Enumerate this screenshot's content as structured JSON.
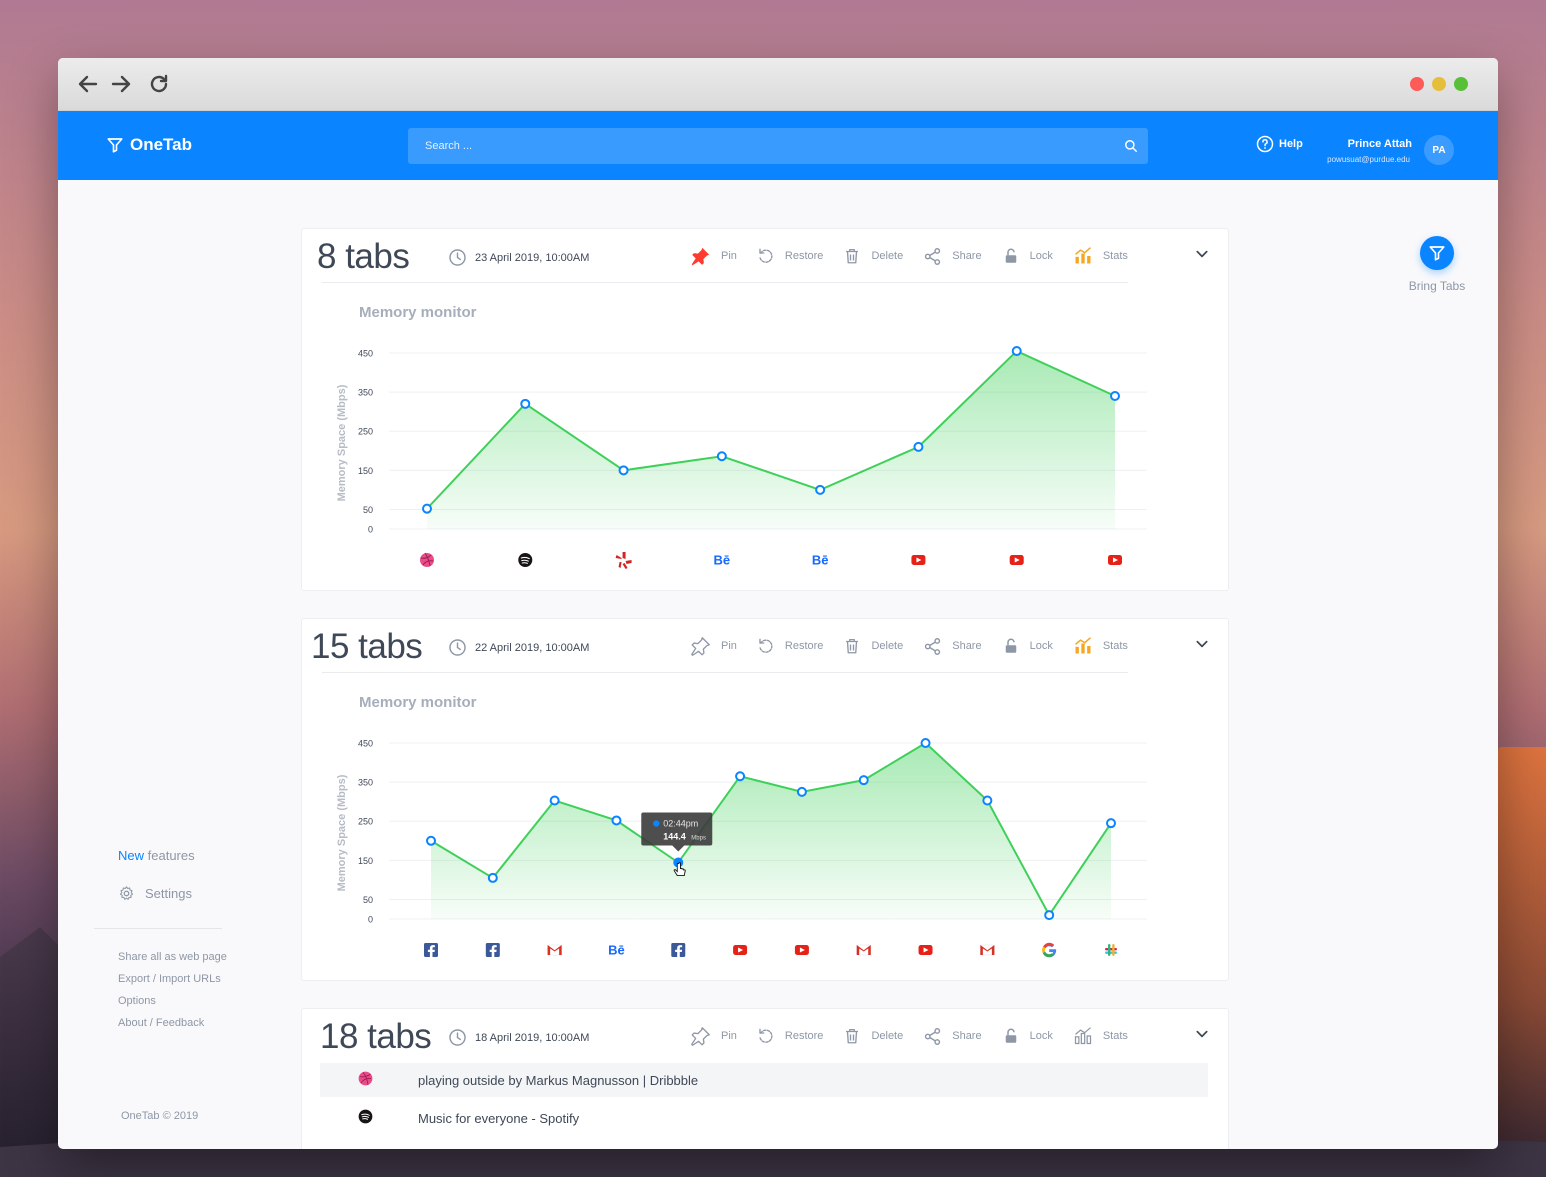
{
  "app": {
    "name": "OneTab"
  },
  "search": {
    "placeholder": "Search ..."
  },
  "header": {
    "help_label": "Help",
    "user_name": "Prince Attah",
    "user_email": "powusuat@purdue.edu",
    "user_initials": "PA"
  },
  "sidebar": {
    "new_label": "New",
    "features_label": "features",
    "settings_label": "Settings",
    "links": [
      "Share all as web page",
      "Export / Import URLs",
      "Options",
      "About / Feedback"
    ],
    "copyright": "OneTab © 2019"
  },
  "bring_tabs": {
    "label": "Bring Tabs"
  },
  "colors": {
    "accent": "#0a84ff",
    "line": "#3fd05a",
    "area": "#3fd05a",
    "pin_active": "#ff3b30",
    "stats_active": "#f5a623",
    "icon_muted": "#8e97a6"
  },
  "actions": {
    "pin": "Pin",
    "restore": "Restore",
    "delete": "Delete",
    "share": "Share",
    "lock": "Lock",
    "stats": "Stats"
  },
  "groups": [
    {
      "count_label": "8 tabs",
      "date": "23 April 2019, 10:00AM",
      "pinned": true,
      "stats_active": true,
      "chart_title": "Memory monitor"
    },
    {
      "count_label": "15 tabs",
      "date": "22 April 2019, 10:00AM",
      "pinned": false,
      "stats_active": true,
      "chart_title": "Memory monitor",
      "tooltip": {
        "time": "02:44pm",
        "value": "144.4",
        "unit": "Mbps"
      }
    },
    {
      "count_label": "18 tabs",
      "date": "18 April 2019, 10:00AM",
      "pinned": false,
      "stats_active": false,
      "tabs": [
        {
          "icon": "dribbble-icon",
          "title": "playing outside by Markus Magnusson | Dribbble"
        },
        {
          "icon": "spotify-icon",
          "title": "Music for everyone - Spotify"
        }
      ]
    }
  ],
  "chart_data": [
    {
      "type": "area",
      "title": "Memory monitor",
      "ylabel": "Memory Space (Mbps)",
      "ylim": [
        0,
        450
      ],
      "yticks": [
        0,
        50,
        150,
        250,
        350,
        450
      ],
      "grid": true,
      "categories": [
        "dribbble",
        "spotify",
        "yelp",
        "behance",
        "behance",
        "youtube",
        "youtube",
        "youtube"
      ],
      "values": [
        52,
        320,
        150,
        186,
        100,
        210,
        455,
        340
      ]
    },
    {
      "type": "area",
      "title": "Memory monitor",
      "ylabel": "Memory Space (Mbps)",
      "ylim": [
        0,
        450
      ],
      "yticks": [
        0,
        50,
        150,
        250,
        350,
        450
      ],
      "grid": true,
      "categories": [
        "facebook",
        "facebook",
        "gmail",
        "behance",
        "facebook",
        "youtube",
        "youtube",
        "gmail",
        "youtube",
        "gmail",
        "google",
        "slack"
      ],
      "values": [
        200,
        105,
        303,
        252,
        144.4,
        365,
        325,
        355,
        450,
        303,
        10,
        245
      ]
    }
  ]
}
